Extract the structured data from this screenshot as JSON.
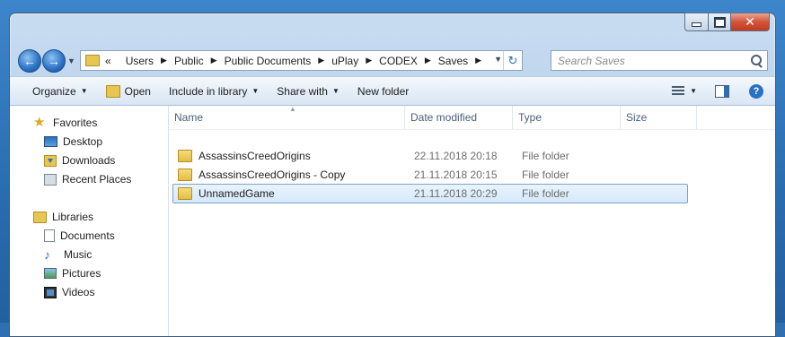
{
  "window": {
    "controls": {
      "minimize": "minimize",
      "maximize": "maximize",
      "close": "✕"
    }
  },
  "navbar": {
    "breadcrumbs": [
      "«",
      "Users",
      "Public",
      "Public Documents",
      "uPlay",
      "CODEX",
      "Saves"
    ],
    "search_placeholder": "Search Saves"
  },
  "toolbar": {
    "organize": "Organize",
    "open": "Open",
    "include_in_library": "Include in library",
    "share_with": "Share with",
    "new_folder": "New folder"
  },
  "sidebar": {
    "favorites_label": "Favorites",
    "favorites": [
      "Desktop",
      "Downloads",
      "Recent Places"
    ],
    "libraries_label": "Libraries",
    "libraries": [
      "Documents",
      "Music",
      "Pictures",
      "Videos"
    ]
  },
  "files": {
    "columns": {
      "name": "Name",
      "date": "Date modified",
      "type": "Type",
      "size": "Size"
    },
    "rows": [
      {
        "name": "AssassinsCreedOrigins",
        "date": "22.11.2018 20:18",
        "type": "File folder"
      },
      {
        "name": "AssassinsCreedOrigins - Copy",
        "date": "21.11.2018 20:15",
        "type": "File folder"
      },
      {
        "name": "UnnamedGame",
        "date": "21.11.2018 20:29",
        "type": "File folder"
      }
    ]
  }
}
